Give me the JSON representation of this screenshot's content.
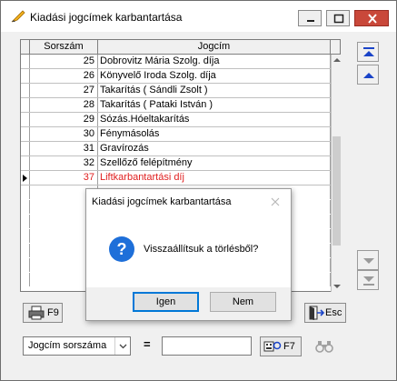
{
  "window": {
    "title": "Kiadási jogcímek karbantartása"
  },
  "grid": {
    "columns": [
      "Sorszám",
      "Jogcím"
    ],
    "rows": [
      {
        "num": "25",
        "name": "Dobrovitz Mária  Szolg. díja"
      },
      {
        "num": "26",
        "name": "Könyvelő Iroda Szolg. díja"
      },
      {
        "num": "27",
        "name": "Takarítás ( Sándli Zsolt )"
      },
      {
        "num": "28",
        "name": "Takarítás ( Pataki István )"
      },
      {
        "num": "29",
        "name": "Sózás.Hóeltakarítás"
      },
      {
        "num": "30",
        "name": "Fénymásolás"
      },
      {
        "num": "31",
        "name": "Gravírozás"
      },
      {
        "num": "32",
        "name": "Szellőző felépítmény"
      },
      {
        "num": "37",
        "name": "Liftkarbantartási díj"
      }
    ],
    "current_row_index": 8
  },
  "buttons": {
    "print_label": "F9",
    "exit_label": "Esc",
    "search_label": "F7"
  },
  "filter": {
    "field_value": "Jogcím sorszáma",
    "operator": "=",
    "search_value": ""
  },
  "dialog": {
    "title": "Kiadási jogcímek karbantartása",
    "message": "Visszaállítsuk a törlésből?",
    "yes_label": "Igen",
    "no_label": "Nem"
  },
  "colors": {
    "current_row_text": "#e02020",
    "nav_arrow": "#1a44c8",
    "dialog_focus": "#0078d7",
    "close_button": "#c9483a"
  },
  "icons": [
    "pen-icon",
    "minimize-icon",
    "maximize-icon",
    "close-icon",
    "first-record-icon",
    "previous-record-icon",
    "next-record-icon",
    "last-record-icon",
    "printer-icon",
    "exit-door-icon",
    "search-key-icon",
    "binoculars-icon",
    "question-icon"
  ]
}
